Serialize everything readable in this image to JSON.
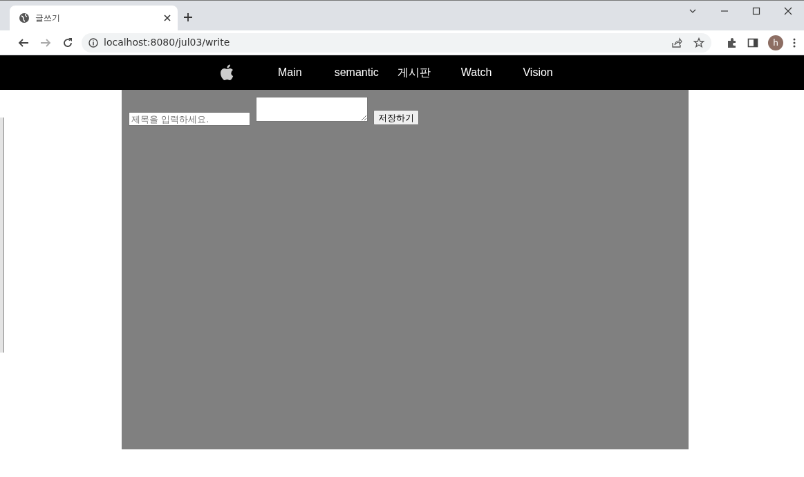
{
  "browser": {
    "tab": {
      "title": "글쓰기",
      "selected": true
    },
    "url": "localhost:8080/jul03/write",
    "profile_initial": "h"
  },
  "nav": {
    "items": [
      {
        "label": "Main"
      },
      {
        "label": "semantic"
      },
      {
        "label": "게시판"
      },
      {
        "label": "Watch"
      },
      {
        "label": "Vision"
      }
    ]
  },
  "form": {
    "title_field": {
      "placeholder": "제목을 입력하세요."
    },
    "save_button": "저장하기"
  }
}
